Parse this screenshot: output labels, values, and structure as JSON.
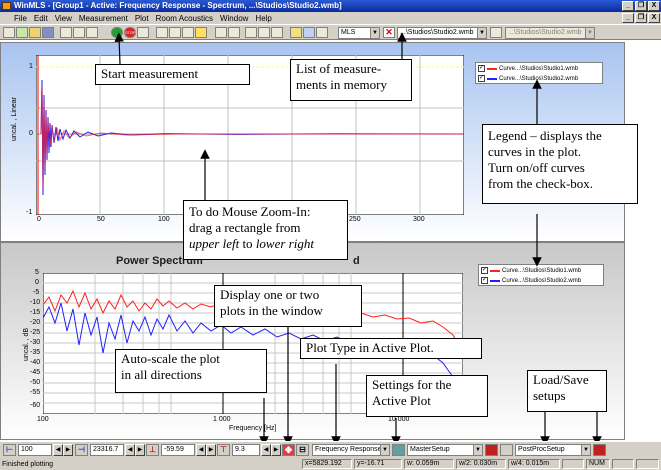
{
  "window": {
    "title": "WinMLS - [Group1 - Active: Frequency Response - Spectrum, ...\\Studios\\Studio2.wmb]",
    "controls": [
      "_",
      "❐",
      "X"
    ]
  },
  "menu": [
    "File",
    "Edit",
    "View",
    "Measurement",
    "Plot",
    "Room Acoustics",
    "Window",
    "Help"
  ],
  "toolbar": {
    "method_combo": "MLS",
    "measurement_combo": "...\\Studios\\Studio2.wmb",
    "inactive_combo": "...\\Studios\\Studio2.wmb",
    "start_button_label": "STOP"
  },
  "plot1": {
    "ylabel": "uncal. , Linear",
    "yticks": [
      "1",
      "0",
      "-1"
    ],
    "xticks": [
      "0",
      "50",
      "100",
      "150",
      "200",
      "250",
      "300"
    ]
  },
  "plot2": {
    "title": "Power Spectrum",
    "title_suffix": "d",
    "ylabel": "uncal. , dB",
    "yticks": [
      "5",
      "0",
      "-5",
      "-10",
      "-15",
      "-20",
      "-25",
      "-30",
      "-35",
      "-40",
      "-45",
      "-50",
      "-55",
      "-60"
    ],
    "xticks": [
      "100",
      "1 000",
      "10 000"
    ],
    "xlabel": "Frequency [Hz]"
  },
  "legend": {
    "items": [
      {
        "label": "Curve...\\Studios\\Studio1.wmb",
        "color": "#ff2020",
        "checked": true
      },
      {
        "label": "Curve...\\Studios\\Studio2.wmb",
        "color": "#2020ff",
        "checked": true
      }
    ]
  },
  "callouts": {
    "start_measurement": "Start measurement",
    "measurement_list_1": "List of measure-",
    "measurement_list_2": "ments in memory",
    "legend_1": "Legend – displays the",
    "legend_2": "curves in the plot.",
    "legend_3": "Turn on/off curves",
    "legend_4": "from the check-box.",
    "zoom_1": "To do Mouse Zoom-In:",
    "zoom_2": "drag a rectangle from",
    "zoom_3a": "upper left",
    "zoom_3b": " to ",
    "zoom_3c": "lower right",
    "display_1": "Display one or two",
    "display_2": "plots in the window",
    "plottype": "Plot Type in Active Plot.",
    "autoscale_1": "Auto-scale the plot",
    "autoscale_2": "in all directions",
    "settings_1": "Settings for the",
    "settings_2": "Active Plot",
    "loadsave_1": "Load/Save",
    "loadsave_2": "setups"
  },
  "bottom": {
    "xmin": "100",
    "xmax": "23316.7",
    "ymin": "-59.59",
    "ymax": "9.3",
    "plot_type": "Frequency Response - S",
    "setup": "MasterSetup",
    "postproc": "PostProcSetup"
  },
  "status": {
    "message": "Finished plotting",
    "x": "x=5829.192",
    "y": "y=-16.71",
    "w": "w: 0.059m",
    "w2": "w/2: 0.030m",
    "w4": "w/4: 0.015m",
    "num": "NUM"
  }
}
